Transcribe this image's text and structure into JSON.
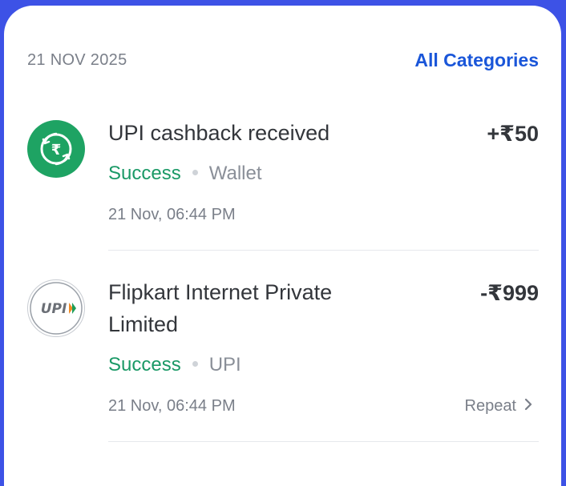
{
  "header": {
    "date": "21 NOV 2025",
    "all_categories_label": "All Categories"
  },
  "transactions": [
    {
      "title": "UPI cashback received",
      "amount": "+₹50",
      "status": "Success",
      "method": "Wallet",
      "time": "21 Nov, 06:44 PM",
      "icon": "rupee-cashback-icon"
    },
    {
      "title_line1": "Flipkart Internet Private",
      "title_line2": "Limited",
      "amount": "-₹999",
      "status": "Success",
      "method": "UPI",
      "time": "21 Nov, 06:44 PM",
      "icon": "upi-logo-icon",
      "repeat_label": "Repeat"
    }
  ],
  "colors": {
    "background": "#3d52e6",
    "accent": "#1a56d9",
    "success": "#1a9966",
    "cashback_icon_bg": "#1ea363"
  }
}
